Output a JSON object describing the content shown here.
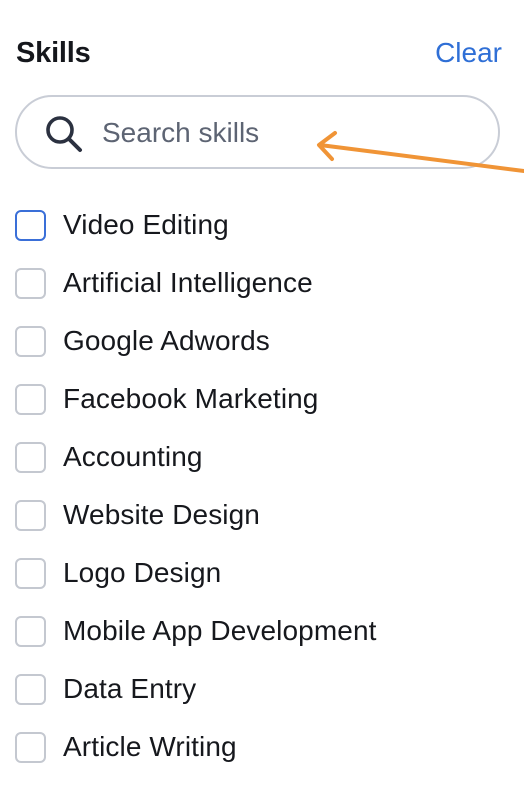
{
  "header": {
    "title": "Skills",
    "clear_label": "Clear"
  },
  "search": {
    "placeholder": "Search skills",
    "value": "",
    "icon": "search-icon"
  },
  "annotation": {
    "arrow_color": "#f09436"
  },
  "colors": {
    "accent": "#2f6fd6",
    "focused_checkbox_border": "#3a6fd8",
    "checkbox_border": "#c4c8d0",
    "text": "#16181d"
  },
  "skills": [
    {
      "label": "Video Editing",
      "checked": false,
      "focused": true
    },
    {
      "label": "Artificial Intelligence",
      "checked": false,
      "focused": false
    },
    {
      "label": "Google Adwords",
      "checked": false,
      "focused": false
    },
    {
      "label": "Facebook Marketing",
      "checked": false,
      "focused": false
    },
    {
      "label": "Accounting",
      "checked": false,
      "focused": false
    },
    {
      "label": "Website Design",
      "checked": false,
      "focused": false
    },
    {
      "label": "Logo Design",
      "checked": false,
      "focused": false
    },
    {
      "label": "Mobile App Development",
      "checked": false,
      "focused": false
    },
    {
      "label": "Data Entry",
      "checked": false,
      "focused": false
    },
    {
      "label": "Article Writing",
      "checked": false,
      "focused": false
    }
  ]
}
